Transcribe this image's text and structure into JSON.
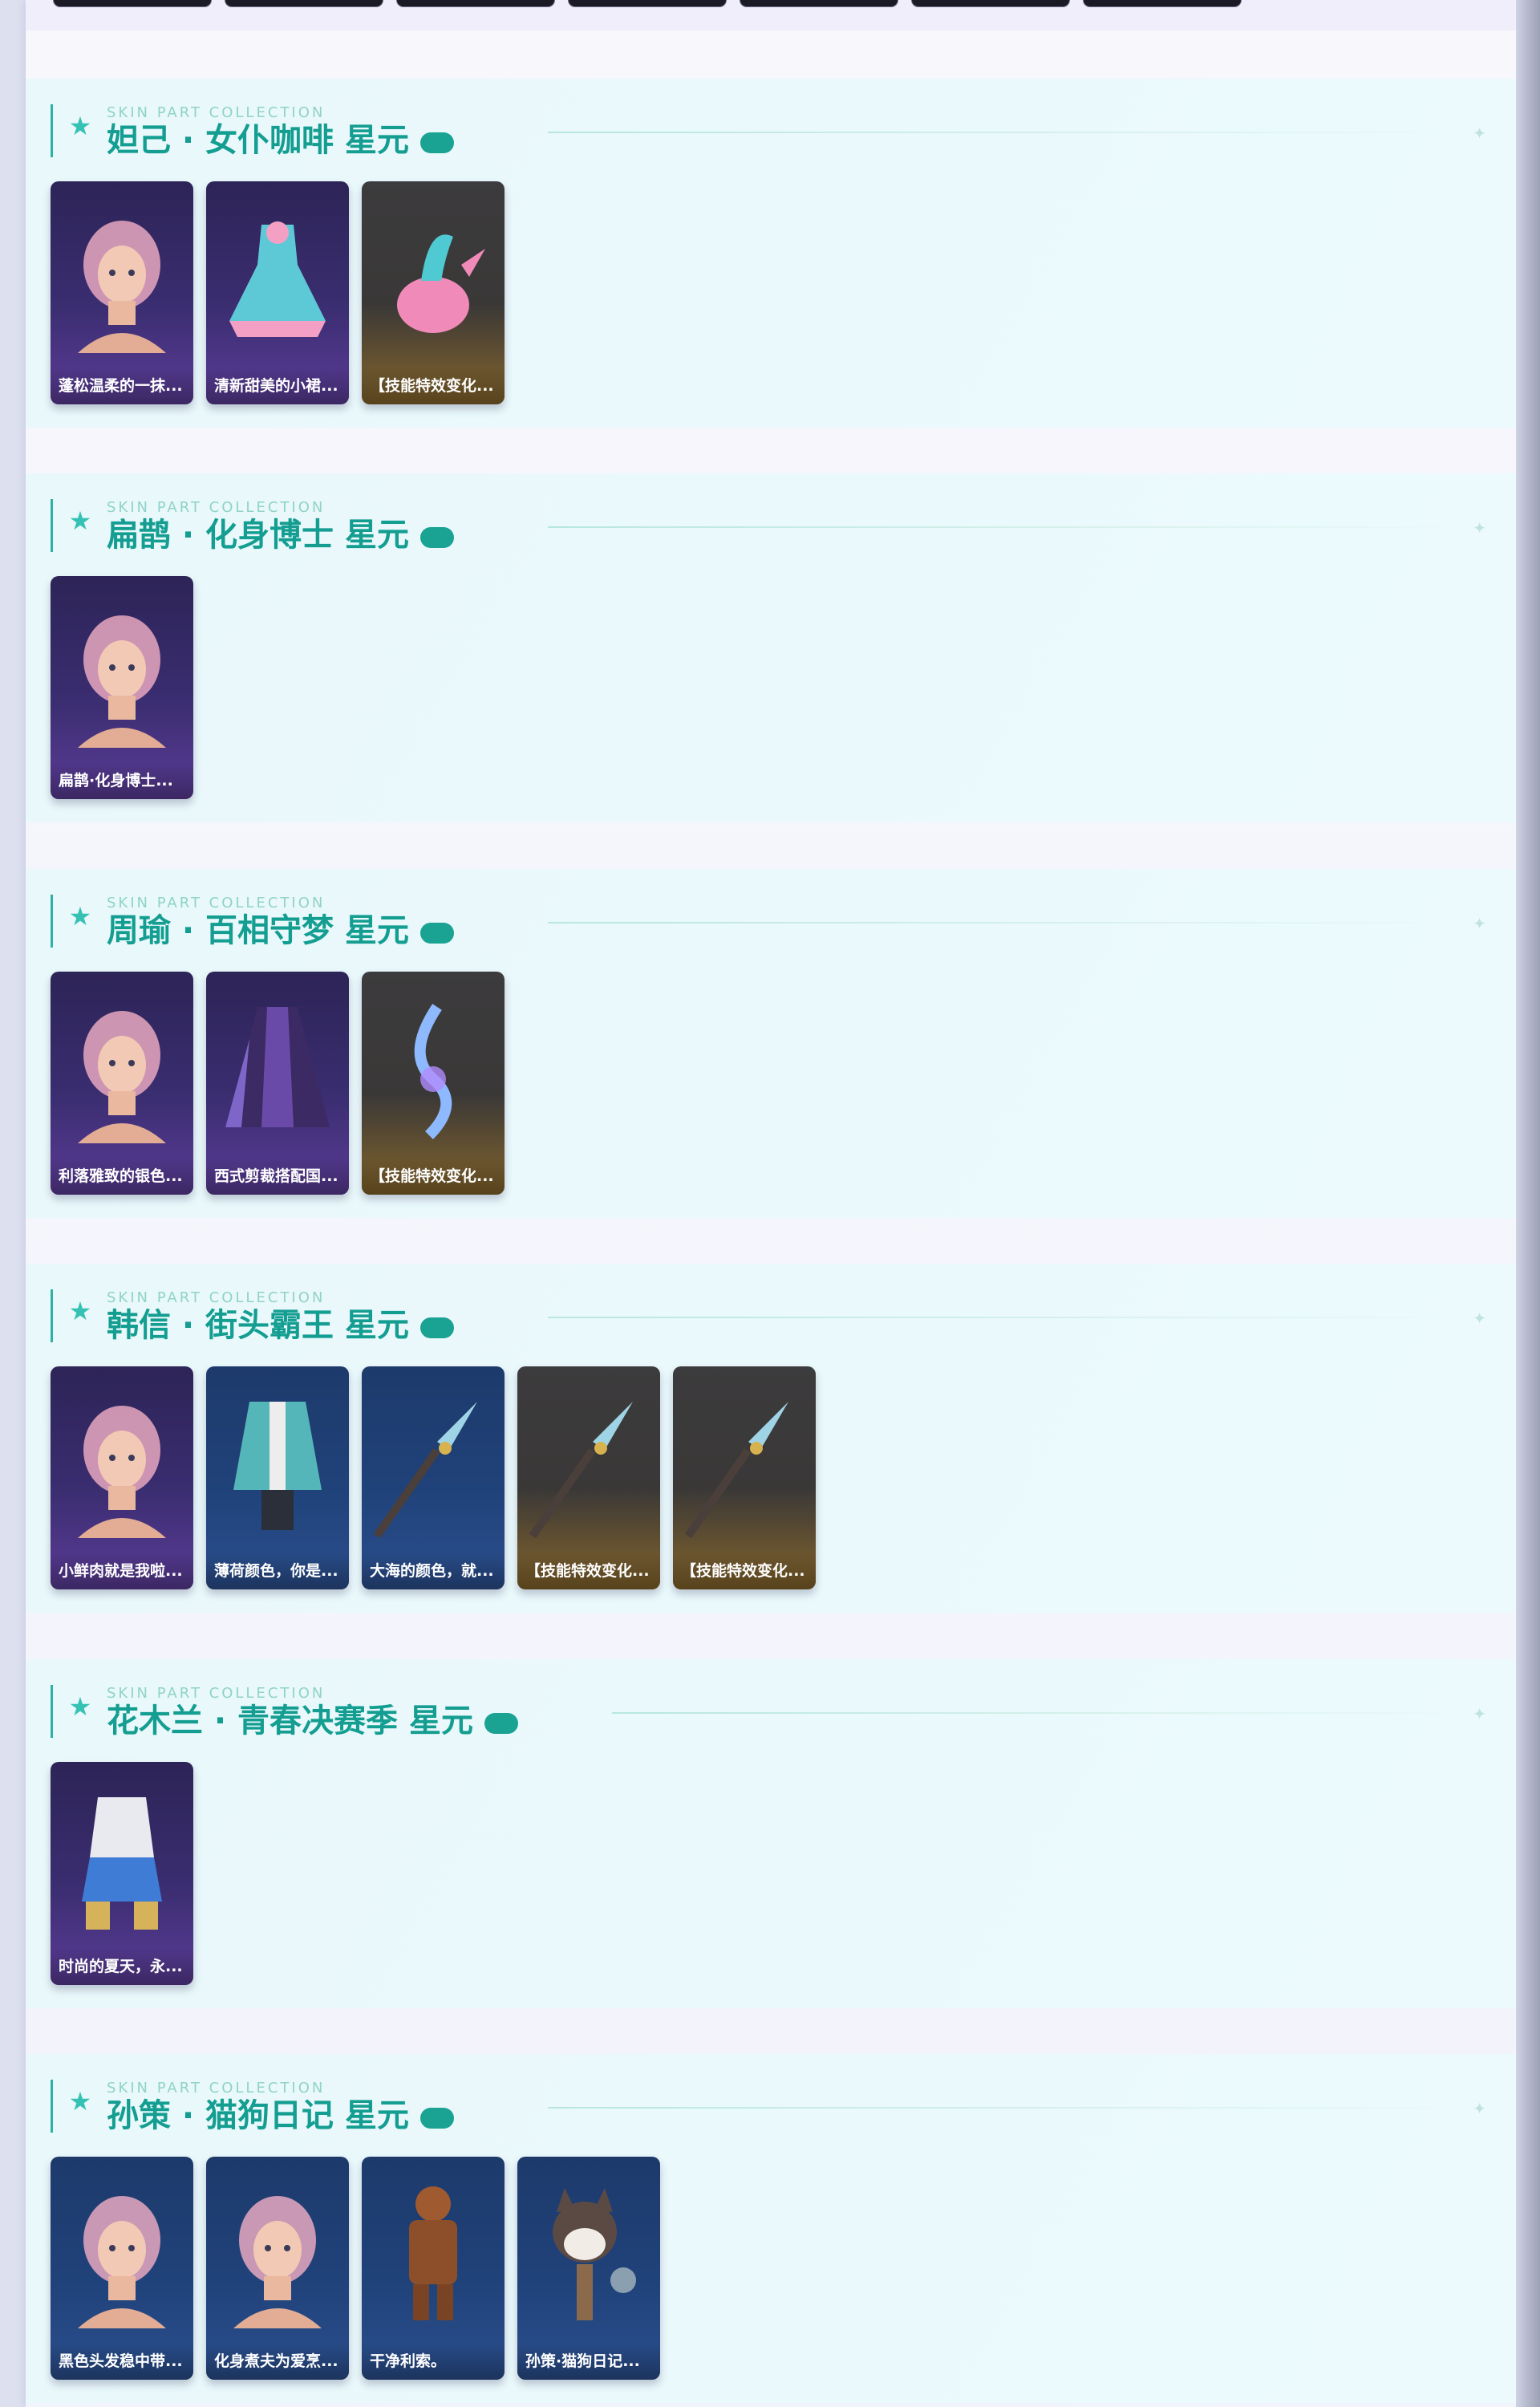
{
  "sections": [
    {
      "caption": "SKIN PART COLLECTION",
      "title": "妲己 · 女仆咖啡 星元",
      "cards": [
        {
          "label": "蓬松温柔的一抹...",
          "theme": "purple",
          "icon": "hero-head-art"
        },
        {
          "label": "清新甜美的小裙...",
          "theme": "purple",
          "icon": "outfit-dress-art"
        },
        {
          "label": "【技能特效变化...",
          "theme": "gold",
          "icon": "teapot-weapon-art"
        }
      ]
    },
    {
      "caption": "SKIN PART COLLECTION",
      "title": "扁鹊 · 化身博士 星元",
      "cards": [
        {
          "label": "扁鹊·化身博士...",
          "theme": "purple",
          "icon": "hero-head-art"
        }
      ]
    },
    {
      "caption": "SKIN PART COLLECTION",
      "title": "周瑜 · 百相守梦 星元",
      "cards": [
        {
          "label": "利落雅致的银色...",
          "theme": "purple",
          "icon": "hero-head-art"
        },
        {
          "label": "西式剪裁搭配国...",
          "theme": "purple",
          "icon": "outfit-coat-art"
        },
        {
          "label": "【技能特效变化...",
          "theme": "gold",
          "icon": "crystal-weapon-art"
        }
      ]
    },
    {
      "caption": "SKIN PART COLLECTION",
      "title": "韩信 · 街头霸王 星元",
      "cards": [
        {
          "label": "小鲜肉就是我啦...",
          "theme": "purple",
          "icon": "hero-head-art"
        },
        {
          "label": "薄荷颜色，你是...",
          "theme": "blue",
          "icon": "outfit-jacket-art"
        },
        {
          "label": "大海的颜色，就...",
          "theme": "blue",
          "icon": "spear-weapon-art"
        },
        {
          "label": "【技能特效变化...",
          "theme": "gold",
          "icon": "spear-weapon-art"
        },
        {
          "label": "【技能特效变化...",
          "theme": "gold",
          "icon": "spear-weapon-art"
        }
      ]
    },
    {
      "caption": "SKIN PART COLLECTION",
      "title": "花木兰 · 青春决赛季 星元",
      "cards": [
        {
          "label": "时尚的夏天，永...",
          "theme": "purple",
          "icon": "outfit-sport-art"
        }
      ]
    },
    {
      "caption": "SKIN PART COLLECTION",
      "title": "孙策 · 猫狗日记 星元",
      "cards": [
        {
          "label": "黑色头发稳中带...",
          "theme": "blue",
          "icon": "hero-head-art"
        },
        {
          "label": "化身煮夫为爱烹...",
          "theme": "blue",
          "icon": "hero-head-art"
        },
        {
          "label": "干净利索。",
          "theme": "blue",
          "icon": "outfit-suit-art"
        },
        {
          "label": "孙策·猫狗日记...",
          "theme": "blue",
          "icon": "dog-pet-art"
        }
      ]
    }
  ]
}
